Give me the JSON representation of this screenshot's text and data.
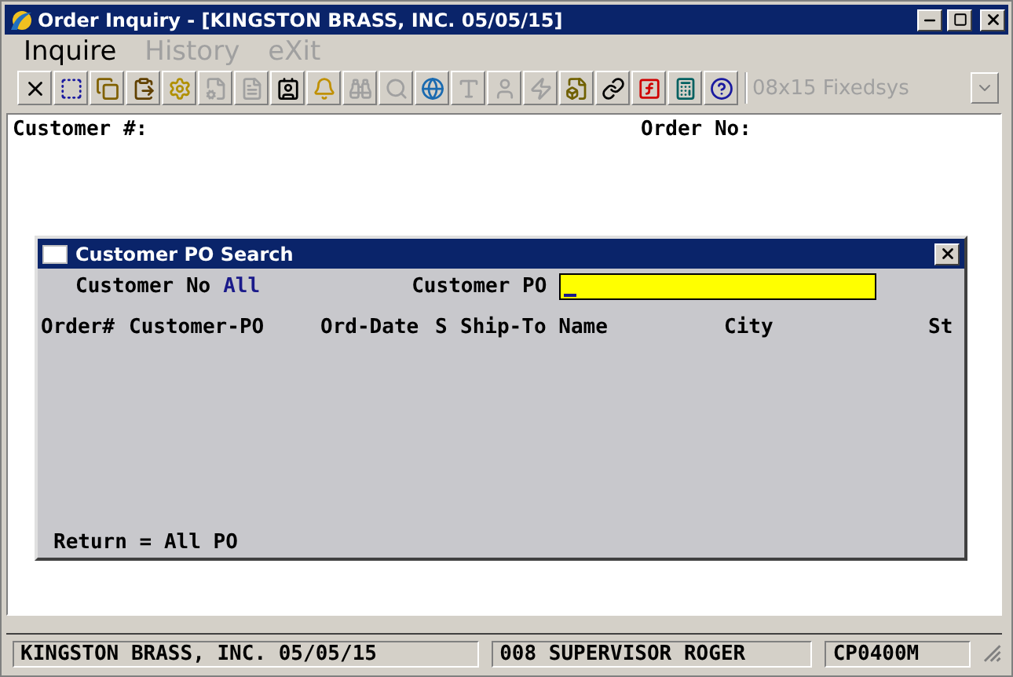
{
  "window": {
    "title": "Order Inquiry - [KINGSTON BRASS, INC. 05/05/15]"
  },
  "menu": [
    {
      "label": "Inquire",
      "disabled": false
    },
    {
      "label": "History",
      "disabled": true
    },
    {
      "label": "eXit",
      "disabled": true
    }
  ],
  "toolbar": [
    {
      "kind": "close",
      "disabled": false
    },
    {
      "kind": "select",
      "disabled": false
    },
    {
      "kind": "copy",
      "disabled": false
    },
    {
      "kind": "paste",
      "disabled": false
    },
    {
      "kind": "gear",
      "disabled": false
    },
    {
      "kind": "properties",
      "disabled": true
    },
    {
      "kind": "list",
      "disabled": true
    },
    {
      "kind": "card",
      "disabled": false
    },
    {
      "kind": "bell",
      "disabled": false
    },
    {
      "kind": "binoculars",
      "disabled": true
    },
    {
      "kind": "search",
      "disabled": true
    },
    {
      "kind": "globe",
      "disabled": false
    },
    {
      "kind": "font",
      "disabled": true
    },
    {
      "kind": "person",
      "disabled": true
    },
    {
      "kind": "lightning",
      "disabled": true
    },
    {
      "kind": "lightning-doc",
      "disabled": false
    },
    {
      "kind": "link",
      "disabled": false
    },
    {
      "kind": "function",
      "disabled": false
    },
    {
      "kind": "calculator",
      "disabled": false
    },
    {
      "kind": "help",
      "disabled": false
    }
  ],
  "font_selector": {
    "value": "08x15 Fixedsys",
    "disabled": true
  },
  "form": {
    "customer_label": "Customer #:",
    "order_label": "Order No:"
  },
  "dialog": {
    "title": "Customer PO Search",
    "customer_no_label": "Customer No",
    "customer_no_value": "All",
    "customer_po_label": "Customer PO",
    "columns": [
      "Order#",
      "Customer-PO",
      "Ord-Date",
      "S",
      "Ship-To Name",
      "City",
      "St"
    ],
    "footer": "Return = All PO"
  },
  "status_bar": [
    "KINGSTON BRASS, INC. 05/05/15",
    "008 SUPERVISOR ROGER",
    "CP0400M"
  ]
}
